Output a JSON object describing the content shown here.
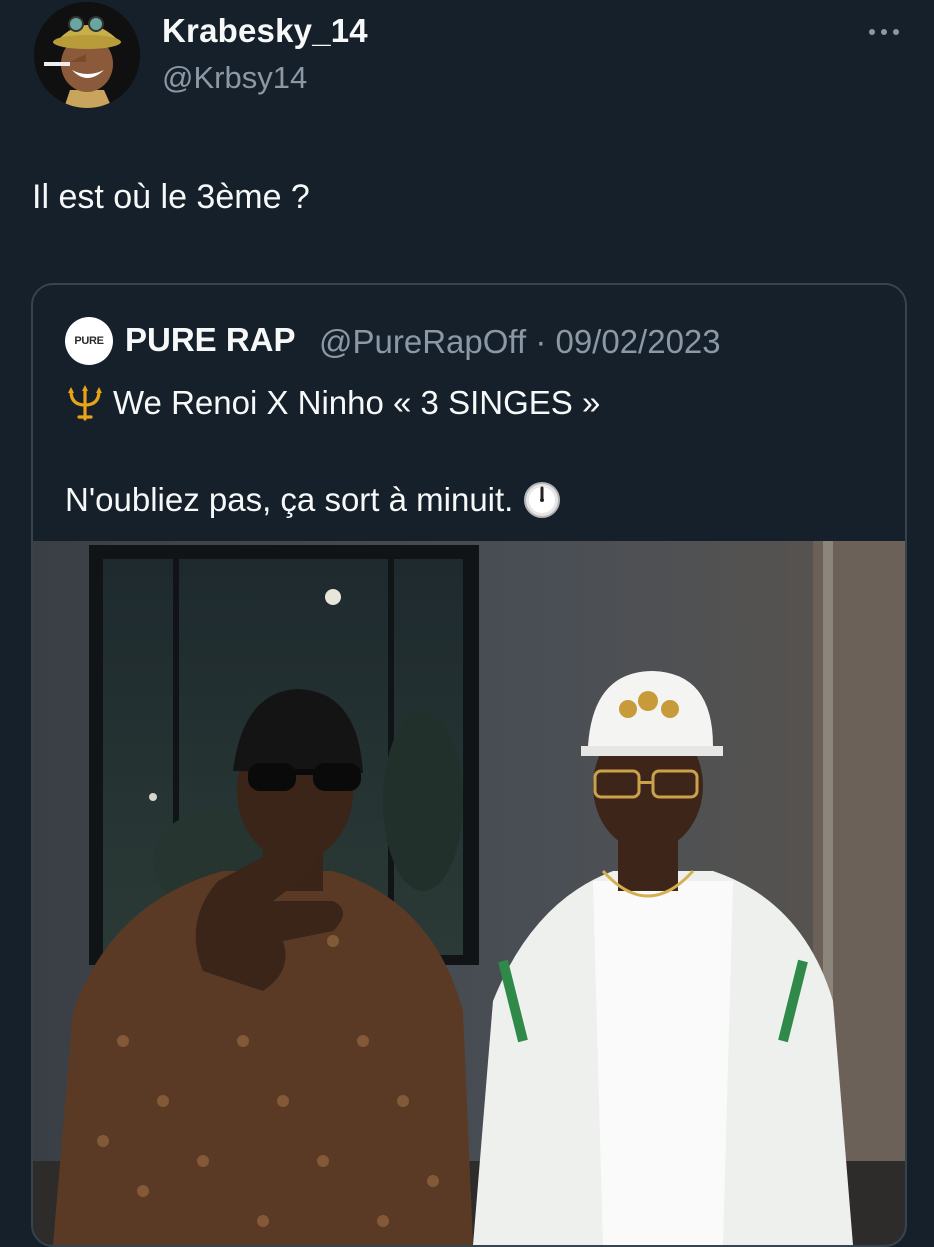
{
  "author": {
    "display_name": "Krabesky_14",
    "handle": "@Krbsy14",
    "avatar_icon": "avatar-icon"
  },
  "tweet": {
    "text": "Il est où le 3ème ?"
  },
  "quoted_tweet": {
    "display_name": "PURE RAP",
    "handle": "@PureRapOff",
    "separator": "·",
    "date": "09/02/2023",
    "meta": "@PureRapOff · 09/02/2023",
    "avatar_label": "PURE",
    "line1_icon": "trident-icon",
    "line1": "We Renoi X Ninho « 3 SINGES »",
    "line2": "N'oubliez pas, ça sort à minuit.",
    "line2_icon": "clock-icon",
    "media_icon": "photo-two-men"
  },
  "colors": {
    "background": "#15202b",
    "text_primary": "#f7f9f9",
    "text_secondary": "#8b98a5",
    "card_border": "#38444d"
  }
}
